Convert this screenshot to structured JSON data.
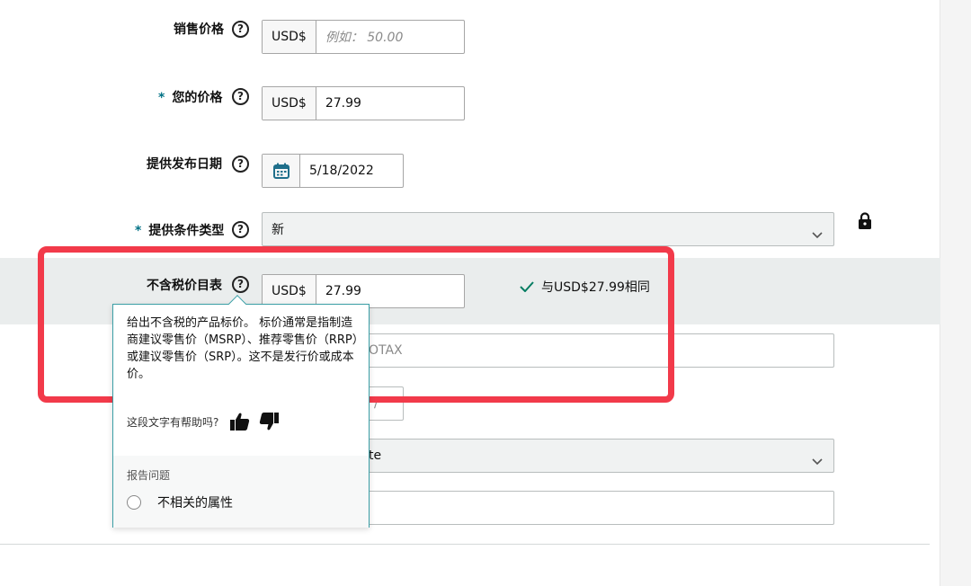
{
  "form": {
    "sale_price": {
      "label": "销售价格",
      "currency": "USD$",
      "placeholder": "例如： 50.00"
    },
    "your_price": {
      "required_mark": "*",
      "label": "您的价格",
      "currency": "USD$",
      "value": "27.99"
    },
    "release_date": {
      "label": "提供发布日期",
      "value": "5/18/2022"
    },
    "condition_type": {
      "required_mark": "*",
      "label": "提供条件类型",
      "value": "新"
    },
    "list_price_ex_tax": {
      "label": "不含税价目表",
      "currency": "USD$",
      "value": "27.99",
      "match_message": "与USD$27.99相同"
    },
    "partial_field_1": {
      "visible_text": "OTAX"
    },
    "partial_field_2": {
      "visible_text": "/"
    },
    "partial_field_3": {
      "visible_text": "te"
    }
  },
  "tooltip": {
    "text": "给出不含税的产品标价。 标价通常是指制造商建议零售价（MSRP）、推荐零售价（RRP）或建议零售价（SRP）。这不是发行价或成本价。",
    "helpful_question": "这段文字有帮助吗?",
    "report_title": "报告问题",
    "report_option": "不相关的属性"
  },
  "colors": {
    "accent_teal": "#007185",
    "highlight_red": "#f23a4a",
    "check_green": "#067d62",
    "band_gray": "#eaeded"
  },
  "icons": [
    "help-icon",
    "calendar-icon",
    "chevron-down-icon",
    "lock-icon",
    "check-icon",
    "thumbs-up-icon",
    "thumbs-down-icon"
  ]
}
